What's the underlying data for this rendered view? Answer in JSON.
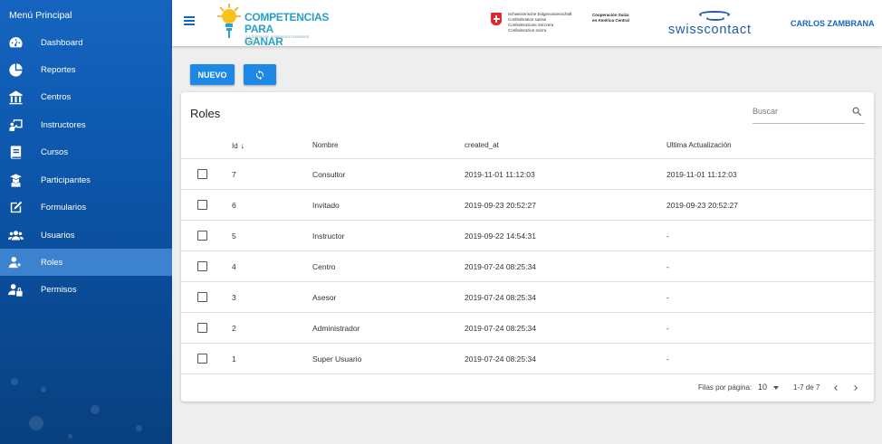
{
  "sidebar": {
    "title": "Menú Principal",
    "items": [
      {
        "label": "Dashboard",
        "icon": "dashboard-icon"
      },
      {
        "label": "Reportes",
        "icon": "pie-chart-icon"
      },
      {
        "label": "Centros",
        "icon": "building-icon"
      },
      {
        "label": "Instructores",
        "icon": "instructor-board-icon"
      },
      {
        "label": "Cursos",
        "icon": "book-icon"
      },
      {
        "label": "Participantes",
        "icon": "graduate-icon"
      },
      {
        "label": "Formularios",
        "icon": "edit-form-icon"
      },
      {
        "label": "Usuarios",
        "icon": "users-icon"
      },
      {
        "label": "Roles",
        "icon": "user-roles-icon",
        "active": true
      },
      {
        "label": "Permisos",
        "icon": "user-lock-icon"
      }
    ]
  },
  "header": {
    "logo": {
      "line1": "COMPETENCIAS",
      "line2": "PARA GANAR",
      "tagline": "¡La formación profesional comienza aquí!"
    },
    "swiss_gov": [
      "Schweizerische Eidgenossenschaft",
      "Confédération suisse",
      "Confederazione Svizzera",
      "Confederaziun svizra"
    ],
    "cosude": [
      "Cooperación Suiza",
      "en América Central"
    ],
    "swisscontact": "swisscontact",
    "user": "CARLOS ZAMBRANA"
  },
  "toolbar": {
    "new_label": "NUEVO",
    "refresh_icon": "refresh-icon"
  },
  "table": {
    "title": "Roles",
    "search_placeholder": "Buscar",
    "columns": {
      "id": "Id",
      "nombre": "Nombre",
      "created_at": "created_at",
      "updated": "Ultima Actualización"
    },
    "sort_arrow": "↓",
    "rows": [
      {
        "id": "7",
        "nombre": "Consultor",
        "created_at": "2019-11-01 11:12:03",
        "updated": "2019-11-01 11:12:03"
      },
      {
        "id": "6",
        "nombre": "Invitado",
        "created_at": "2019-09-23 20:52:27",
        "updated": "2019-09-23 20:52:27"
      },
      {
        "id": "5",
        "nombre": "Instructor",
        "created_at": "2019-09-22 14:54:31",
        "updated": "-"
      },
      {
        "id": "4",
        "nombre": "Centro",
        "created_at": "2019-07-24 08:25:34",
        "updated": "-"
      },
      {
        "id": "3",
        "nombre": "Asesor",
        "created_at": "2019-07-24 08:25:34",
        "updated": "-"
      },
      {
        "id": "2",
        "nombre": "Administrador",
        "created_at": "2019-07-24 08:25:34",
        "updated": "-"
      },
      {
        "id": "1",
        "nombre": "Super Usuario",
        "created_at": "2019-07-24 08:25:34",
        "updated": "-"
      }
    ],
    "footer": {
      "rows_per_page_label": "Filas por página:",
      "rows_per_page": "10",
      "range": "1-7 de 7"
    }
  },
  "colors": {
    "sidebar": "#0d57ad",
    "active": "#3d82cf",
    "primary": "#1e88e5",
    "accent_text": "#1565c0"
  }
}
